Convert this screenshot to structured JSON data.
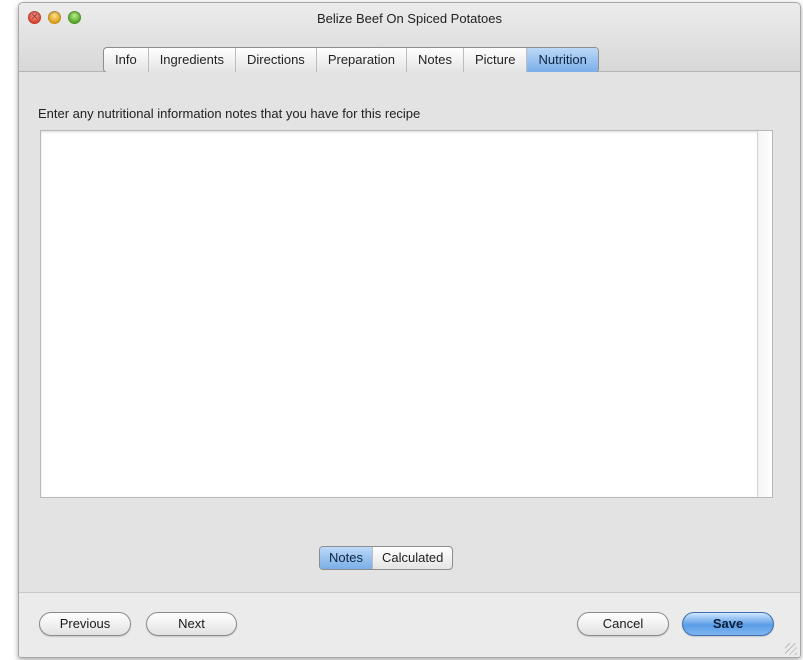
{
  "window": {
    "title": "Belize Beef On Spiced Potatoes"
  },
  "tabs": [
    {
      "label": "Info"
    },
    {
      "label": "Ingredients"
    },
    {
      "label": "Directions"
    },
    {
      "label": "Preparation"
    },
    {
      "label": "Notes"
    },
    {
      "label": "Picture"
    },
    {
      "label": "Nutrition",
      "selected": true
    }
  ],
  "nutrition": {
    "instruction": "Enter any nutritional information notes that you have for this recipe",
    "notes_text": ""
  },
  "mode_switch": [
    {
      "label": "Notes",
      "selected": true
    },
    {
      "label": "Calculated"
    }
  ],
  "footer": {
    "previous_label": "Previous",
    "next_label": "Next",
    "cancel_label": "Cancel",
    "save_label": "Save"
  },
  "icons": {
    "close": "close-icon",
    "minimize": "minimize-icon",
    "zoom": "zoom-icon",
    "resize": "resize-grip-icon"
  },
  "colors": {
    "accent": "#7aaee8",
    "window_background": "#e9e9e9"
  }
}
